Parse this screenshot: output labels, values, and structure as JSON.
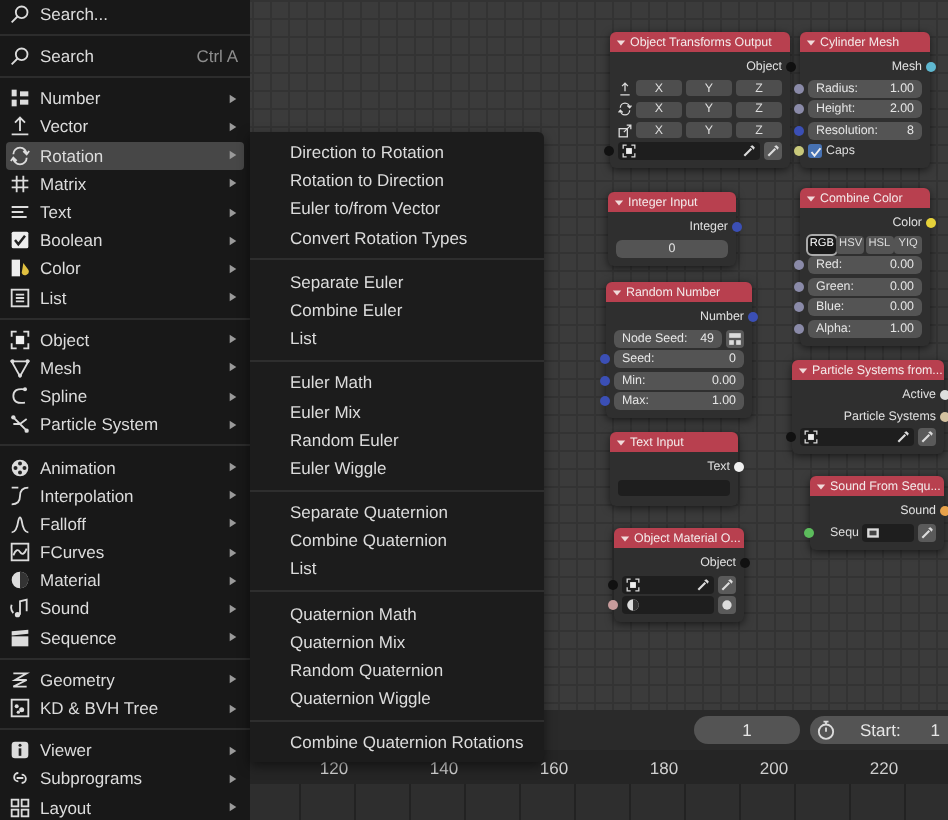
{
  "menu": {
    "search_field": {
      "placeholder": "Search..."
    },
    "sections": [
      [
        {
          "kind": "command",
          "label": "Search",
          "shortcut": "Ctrl A",
          "selected": false
        }
      ],
      [
        {
          "kind": "category",
          "label": "Number",
          "selected": false
        },
        {
          "kind": "category",
          "label": "Vector",
          "selected": false
        },
        {
          "kind": "category",
          "label": "Rotation",
          "selected": true
        },
        {
          "kind": "category",
          "label": "Matrix",
          "selected": false
        },
        {
          "kind": "category",
          "label": "Text",
          "selected": false
        },
        {
          "kind": "category",
          "label": "Boolean",
          "selected": false
        },
        {
          "kind": "category",
          "label": "Color",
          "selected": false
        },
        {
          "kind": "category",
          "label": "List",
          "selected": false
        }
      ],
      [
        {
          "kind": "category",
          "label": "Object",
          "selected": false
        },
        {
          "kind": "category",
          "label": "Mesh",
          "selected": false
        },
        {
          "kind": "category",
          "label": "Spline",
          "selected": false
        },
        {
          "kind": "category",
          "label": "Particle System",
          "selected": false
        }
      ],
      [
        {
          "kind": "category",
          "label": "Animation",
          "selected": false
        },
        {
          "kind": "category",
          "label": "Interpolation",
          "selected": false
        },
        {
          "kind": "category",
          "label": "Falloff",
          "selected": false
        },
        {
          "kind": "category",
          "label": "FCurves",
          "selected": false
        },
        {
          "kind": "category",
          "label": "Material",
          "selected": false
        },
        {
          "kind": "category",
          "label": "Sound",
          "selected": false
        },
        {
          "kind": "category",
          "label": "Sequence",
          "selected": false
        }
      ],
      [
        {
          "kind": "category",
          "label": "Geometry",
          "selected": false
        },
        {
          "kind": "category",
          "label": "KD & BVH Tree",
          "selected": false
        }
      ],
      [
        {
          "kind": "category",
          "label": "Viewer",
          "selected": false
        },
        {
          "kind": "category",
          "label": "Subprograms",
          "selected": false
        },
        {
          "kind": "category",
          "label": "Layout",
          "selected": false
        }
      ]
    ]
  },
  "submenu": {
    "sections": [
      [
        {
          "label": "Direction to Rotation",
          "selected": false
        },
        {
          "label": "Rotation to Direction",
          "selected": false
        },
        {
          "label": "Euler to/from Vector",
          "selected": false
        },
        {
          "label": "Convert Rotation Types",
          "selected": false
        }
      ],
      [
        {
          "label": "Separate Euler",
          "selected": false
        },
        {
          "label": "Combine Euler",
          "selected": false
        },
        {
          "label": "List",
          "selected": false
        }
      ],
      [
        {
          "label": "Euler Math",
          "selected": false
        },
        {
          "label": "Euler Mix",
          "selected": false
        },
        {
          "label": "Random Euler",
          "selected": false
        },
        {
          "label": "Euler Wiggle",
          "selected": false
        }
      ],
      [
        {
          "label": "Separate Quaternion",
          "selected": false
        },
        {
          "label": "Combine Quaternion",
          "selected": false
        },
        {
          "label": "List",
          "selected": false
        }
      ],
      [
        {
          "label": "Quaternion Math",
          "selected": false
        },
        {
          "label": "Quaternion Mix",
          "selected": false
        },
        {
          "label": "Random Quaternion",
          "selected": false
        },
        {
          "label": "Quaternion Wiggle",
          "selected": false
        }
      ],
      [
        {
          "label": "Combine Quaternion Rotations",
          "selected": false
        }
      ]
    ]
  },
  "nodes": [
    {
      "title": "Object Transforms Output",
      "rows": [
        {
          "kind": "output",
          "label": "Object",
          "color": "#111111"
        },
        {
          "kind": "xyz",
          "cells": [
            "X",
            "Y",
            "Z"
          ]
        },
        {
          "kind": "xyz",
          "cells": [
            "X",
            "Y",
            "Z"
          ]
        },
        {
          "kind": "xyz",
          "cells": [
            "X",
            "Y",
            "Z"
          ]
        },
        {
          "kind": "object",
          "color": "#111111"
        }
      ]
    },
    {
      "title": "Cylinder Mesh",
      "rows": [
        {
          "kind": "output",
          "label": "Mesh",
          "color": "#5fb8d0"
        },
        {
          "kind": "value",
          "label": "Radius:",
          "value": "1.00",
          "color": "#8a8aa8"
        },
        {
          "kind": "value",
          "label": "Height:",
          "value": "2.00",
          "color": "#8a8aa8"
        },
        {
          "kind": "value",
          "label": "Resolution:",
          "value": "8",
          "color": "#3b4fb5"
        },
        {
          "kind": "check",
          "label": "Caps",
          "checked": true,
          "color": "#c8c87a"
        }
      ]
    },
    {
      "title": "Integer Input",
      "rows": [
        {
          "kind": "output",
          "label": "Integer",
          "color": "#3b4fb5"
        },
        {
          "kind": "number",
          "value": "0"
        }
      ]
    },
    {
      "title": "Combine Color",
      "rows": [
        {
          "kind": "output",
          "label": "Color",
          "color": "#e6d23a"
        },
        {
          "kind": "modes",
          "options": [
            {
              "label": "RGB",
              "selected": true
            },
            {
              "label": "HSV",
              "selected": false
            },
            {
              "label": "HSL",
              "selected": false
            },
            {
              "label": "YIQ",
              "selected": false
            }
          ]
        },
        {
          "kind": "value",
          "label": "Red:",
          "value": "0.00",
          "color": "#8a8aa8"
        },
        {
          "kind": "value",
          "label": "Green:",
          "value": "0.00",
          "color": "#8a8aa8"
        },
        {
          "kind": "value",
          "label": "Blue:",
          "value": "0.00",
          "color": "#8a8aa8"
        },
        {
          "kind": "value",
          "label": "Alpha:",
          "value": "1.00",
          "color": "#8a8aa8"
        }
      ]
    },
    {
      "title": "Random Number",
      "rows": [
        {
          "kind": "output",
          "label": "Number",
          "color": "#3b4fb5"
        },
        {
          "kind": "seed",
          "label": "Node Seed:",
          "value": "49"
        },
        {
          "kind": "value",
          "label": "Seed:",
          "value": "0",
          "color": "#3b4fb5"
        },
        {
          "kind": "value",
          "label": "Min:",
          "value": "0.00",
          "color": "#3b4fb5"
        },
        {
          "kind": "value",
          "label": "Max:",
          "value": "1.00",
          "color": "#3b4fb5"
        }
      ]
    },
    {
      "title": "Particle Systems from...",
      "rows": [
        {
          "kind": "output",
          "label": "Active",
          "color": "#dddddd"
        },
        {
          "kind": "output",
          "label": "Particle Systems",
          "color": "#d4c2a0"
        },
        {
          "kind": "object",
          "color": "#111111"
        }
      ]
    },
    {
      "title": "Text Input",
      "rows": [
        {
          "kind": "output",
          "label": "Text",
          "color": "#f0f0f0"
        },
        {
          "kind": "text"
        }
      ]
    },
    {
      "title": "Sound From Sequ...",
      "rows": [
        {
          "kind": "output",
          "label": "Sound",
          "color": "#e8a24a"
        },
        {
          "kind": "sequence",
          "label": "Sequ",
          "color": "#5cbc5c"
        }
      ]
    },
    {
      "title": "Object Material O...",
      "rows": [
        {
          "kind": "output",
          "label": "Object",
          "color": "#111111"
        },
        {
          "kind": "object",
          "color": "#111111"
        },
        {
          "kind": "material",
          "color": "#c89c9c"
        }
      ]
    }
  ],
  "timeline": {
    "current_frame": "1",
    "start_label": "Start:",
    "start_value": "1",
    "ruler": [
      "120",
      "140",
      "160",
      "180",
      "200",
      "220"
    ]
  }
}
